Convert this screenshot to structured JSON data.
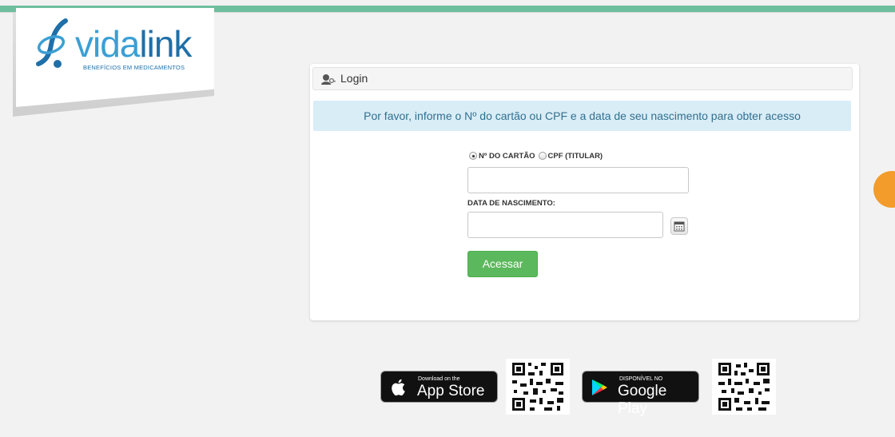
{
  "logo": {
    "word_part1": "vida",
    "word_part2": "link",
    "subtitle": "BENEFÍCIOS EM MEDICAMENTOS"
  },
  "panel": {
    "title": "Login",
    "notice": "Por favor, informe o Nº do cartão ou CPF e a data de seu nascimento para obter acesso"
  },
  "form": {
    "radio_card_label": "Nº DO CARTÃO",
    "radio_cpf_label": "CPF (TITULAR)",
    "selected": "card",
    "id_value": "",
    "birth_label": "DATA DE NASCIMENTO:",
    "birth_value": "",
    "submit_label": "Acessar"
  },
  "stores": {
    "apple_small": "Download on the",
    "apple_big": "App Store",
    "google_small": "DISPONÍVEL NO",
    "google_big": "Google Play"
  },
  "colors": {
    "brand_green": "#6dbf9e",
    "accent_orange": "#f39c2b",
    "button_green": "#5cb85c",
    "alert_bg": "#d9edf7"
  }
}
